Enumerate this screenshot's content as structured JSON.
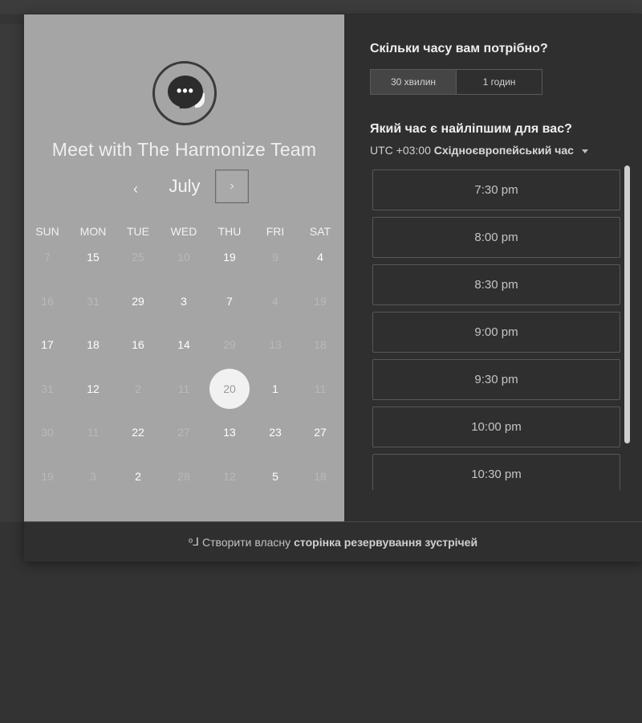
{
  "left": {
    "title": "Meet with The Harmonize Team",
    "month": "July",
    "prev": "‹",
    "next": "›",
    "weekdays": [
      "SUN",
      "MON",
      "TUE",
      "WED",
      "THU",
      "FRI",
      "SAT"
    ],
    "weeks": [
      [
        {
          "d": "7",
          "a": false
        },
        {
          "d": "15",
          "a": true
        },
        {
          "d": "25",
          "a": false
        },
        {
          "d": "10",
          "a": false
        },
        {
          "d": "19",
          "a": true
        },
        {
          "d": "9",
          "a": false
        },
        {
          "d": "4",
          "a": true
        }
      ],
      [
        {
          "d": "16",
          "a": false
        },
        {
          "d": "31",
          "a": false
        },
        {
          "d": "29",
          "a": true
        },
        {
          "d": "3",
          "a": true
        },
        {
          "d": "7",
          "a": true
        },
        {
          "d": "4",
          "a": false
        },
        {
          "d": "19",
          "a": false
        }
      ],
      [
        {
          "d": "17",
          "a": true
        },
        {
          "d": "18",
          "a": true
        },
        {
          "d": "16",
          "a": true
        },
        {
          "d": "14",
          "a": true
        },
        {
          "d": "29",
          "a": false
        },
        {
          "d": "13",
          "a": false
        },
        {
          "d": "18",
          "a": false
        }
      ],
      [
        {
          "d": "31",
          "a": false
        },
        {
          "d": "12",
          "a": true
        },
        {
          "d": "2",
          "a": false
        },
        {
          "d": "11",
          "a": false
        },
        {
          "d": "20",
          "a": true,
          "selected": true
        },
        {
          "d": "1",
          "a": true
        },
        {
          "d": "11",
          "a": false
        }
      ],
      [
        {
          "d": "30",
          "a": false
        },
        {
          "d": "11",
          "a": false
        },
        {
          "d": "22",
          "a": true
        },
        {
          "d": "27",
          "a": false
        },
        {
          "d": "13",
          "a": true
        },
        {
          "d": "23",
          "a": true
        },
        {
          "d": "27",
          "a": true
        }
      ],
      [
        {
          "d": "19",
          "a": false
        },
        {
          "d": "3",
          "a": false
        },
        {
          "d": "2",
          "a": true
        },
        {
          "d": "28",
          "a": false
        },
        {
          "d": "12",
          "a": false
        },
        {
          "d": "5",
          "a": true
        },
        {
          "d": "18",
          "a": false
        }
      ]
    ]
  },
  "right": {
    "duration_question": "Скільки часу вам потрібно?",
    "durations": [
      "30 хвилин",
      "1 годин"
    ],
    "time_question": "Який час є найліпшим для вас?",
    "tz_prefix": "UTC +03:00",
    "tz_name": "Східноєвропейський час",
    "slots": [
      "7:30 pm",
      "8:00 pm",
      "8:30 pm",
      "9:00 pm",
      "9:30 pm",
      "10:00 pm",
      "10:30 pm"
    ]
  },
  "footer": {
    "prefix": "Створити власну",
    "link": "сторінка резервування зустрічей"
  }
}
